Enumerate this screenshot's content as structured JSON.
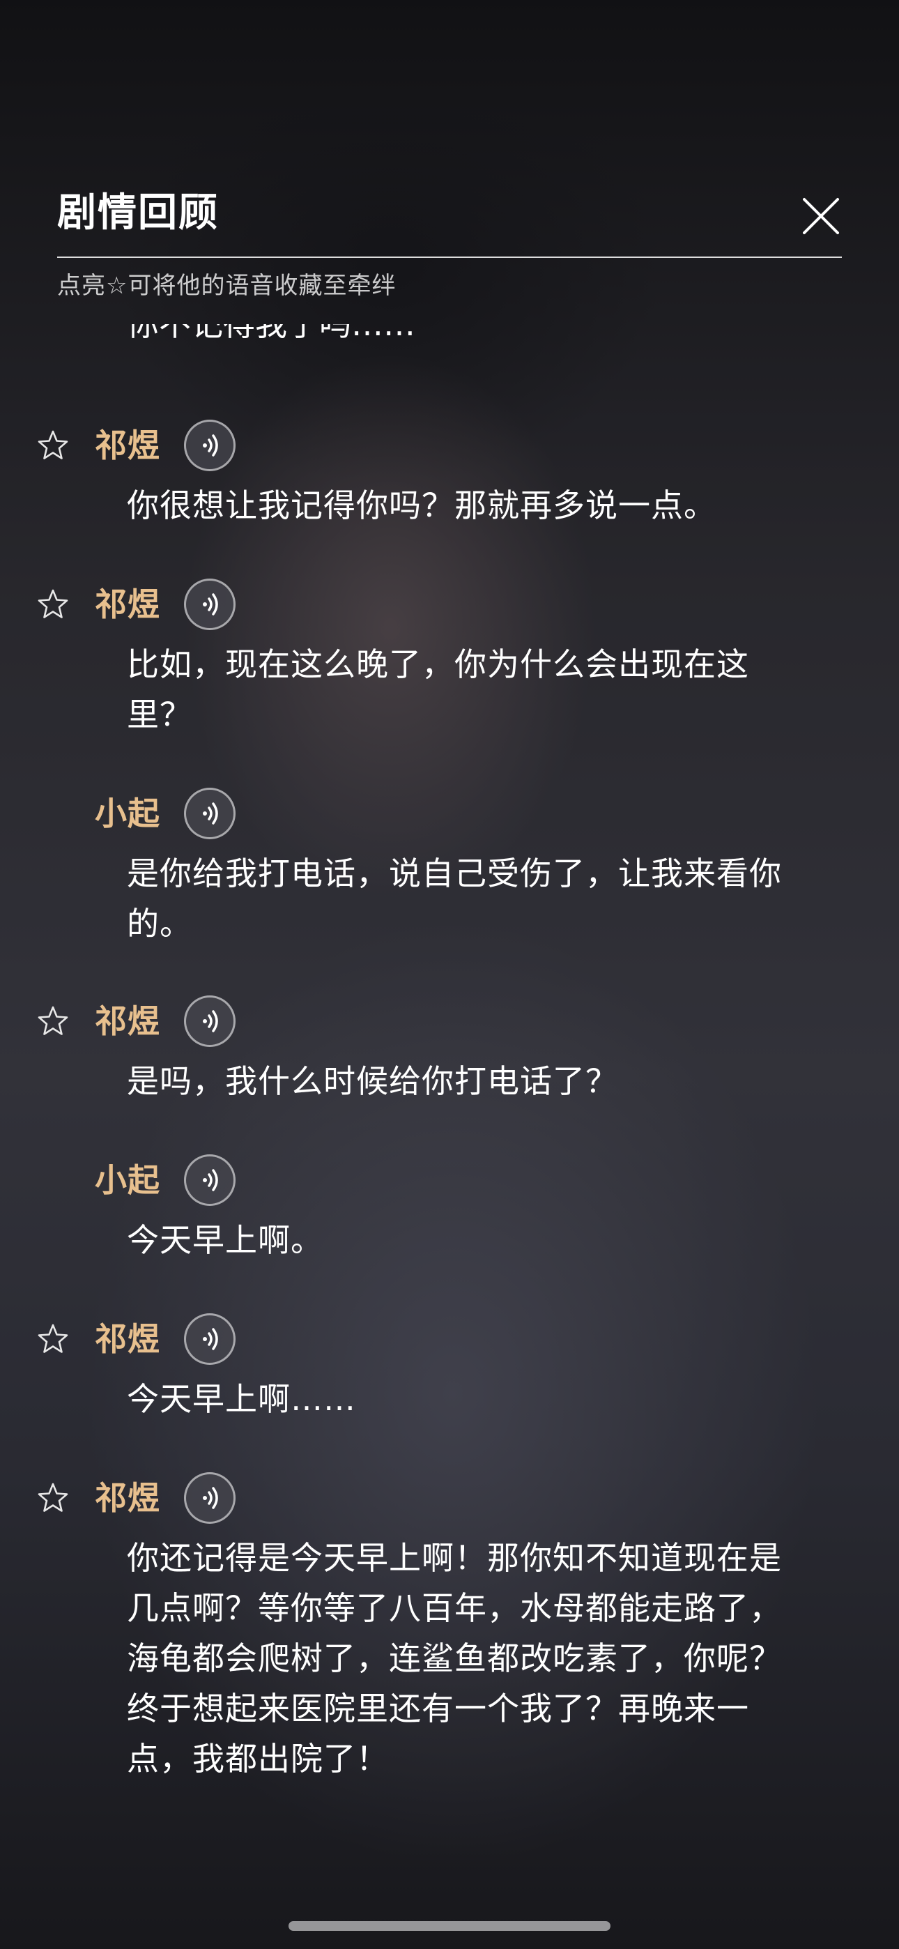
{
  "header": {
    "title": "剧情回顾",
    "hint": "点亮☆可将他的语音收藏至牵绊"
  },
  "partial_line": "你不记得我了吗……",
  "messages": [
    {
      "speaker": "祁煜",
      "star": true,
      "text": "你很想让我记得你吗？那就再多说一点。"
    },
    {
      "speaker": "祁煜",
      "star": true,
      "text": "比如，现在这么晚了，你为什么会出现在这里？"
    },
    {
      "speaker": "小起",
      "star": false,
      "text": "是你给我打电话，说自己受伤了，让我来看你的。"
    },
    {
      "speaker": "祁煜",
      "star": true,
      "text": "是吗，我什么时候给你打电话了？"
    },
    {
      "speaker": "小起",
      "star": false,
      "text": "今天早上啊。"
    },
    {
      "speaker": "祁煜",
      "star": true,
      "text": "今天早上啊……"
    },
    {
      "speaker": "祁煜",
      "star": true,
      "text": "你还记得是今天早上啊！那你知不知道现在是几点啊？等你等了八百年，水母都能走路了，海龟都会爬树了，连鲨鱼都改吃素了，你呢？终于想起来医院里还有一个我了？再晚来一点，我都出院了！"
    }
  ],
  "icons": {
    "close": "close-icon",
    "star": "star-outline-icon",
    "voice": "voice-play-icon"
  },
  "colors": {
    "speaker_name": "#e8c08e",
    "text": "#ffffff"
  }
}
